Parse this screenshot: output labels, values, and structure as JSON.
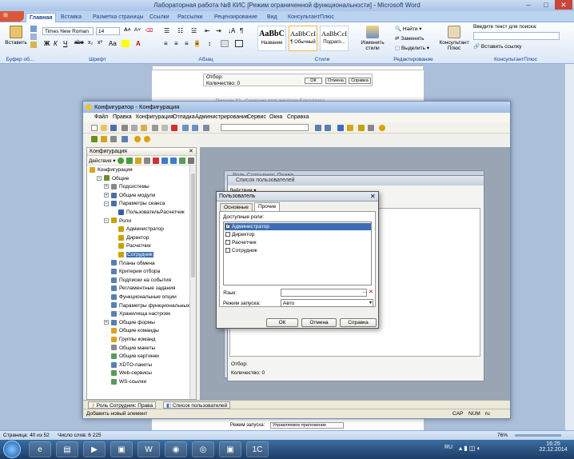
{
  "word": {
    "title": "Лабораторная работа №8 КИС [Режим ограниченной функциональности] - Microsoft Word",
    "tabs": [
      "Главная",
      "Вставка",
      "Разметка страницы",
      "Ссылки",
      "Рассылки",
      "Рецензирование",
      "Вид",
      "КонсультантПлюс"
    ],
    "font_name": "Times New Roman",
    "font_size": "14",
    "paste_label": "Вставить",
    "styles": [
      {
        "preview": "AaBbC",
        "name": "Название"
      },
      {
        "preview": "AaBbCcI",
        "name": "¶ Обычный"
      },
      {
        "preview": "AaBbCcI",
        "name": "Подзаго..."
      }
    ],
    "change_styles": "Изменить стили",
    "find": "Найти",
    "replace": "Заменить",
    "select": "Выделить",
    "consultant": "Консультант Плюс",
    "search_label": "Введите текст для поиска:",
    "insert_link": "Вставить ссылку",
    "groups": [
      "Буфер об...",
      "Шрифт",
      "Абзац",
      "Стили",
      "Редактирование",
      "КонсультантПлюс"
    ],
    "status": {
      "page": "Страница: 40 из 52",
      "words": "Число слов: 6 225",
      "zoom": "76%"
    },
    "page_snippet": {
      "selection": "Отбор:",
      "count": "Количество: 0",
      "ok": "ОК",
      "cancel": "Отмена",
      "help": "Справка",
      "caption": "Рисунок 32 - Создание пользователя Бухгалтера",
      "startup_label": "Режим запуска:",
      "startup_value": "Управляемое приложение"
    }
  },
  "taskbar": {
    "lang": "RU",
    "time": "16:25",
    "date": "22.12.2014"
  },
  "configurator": {
    "title": "Конфигуратор - Конфигурация",
    "menu": [
      "Файл",
      "Правка",
      "Конфигурация",
      "Отладка",
      "Администрирование",
      "Сервис",
      "Окна",
      "Справка"
    ],
    "tree_header": "Конфигурация",
    "tree_actions": "Действия",
    "tree": [
      {
        "label": "Конфигурация",
        "level": 0,
        "exp": "",
        "color": "#d9a520"
      },
      {
        "label": "Общие",
        "level": 1,
        "exp": "−",
        "color": "#6b8e23"
      },
      {
        "label": "Подсистемы",
        "level": 2,
        "exp": "+",
        "color": "#8a8a8a"
      },
      {
        "label": "Общие модули",
        "level": 2,
        "exp": "+",
        "color": "#4a6fa5"
      },
      {
        "label": "Параметры сеанса",
        "level": 2,
        "exp": "−",
        "color": "#4a6fa5"
      },
      {
        "label": "ПользовательРасчетчик",
        "level": 3,
        "exp": "",
        "color": "#2f5fa0"
      },
      {
        "label": "Роли",
        "level": 2,
        "exp": "−",
        "color": "#c8a200"
      },
      {
        "label": "Администратор",
        "level": 3,
        "exp": "",
        "color": "#c8a200"
      },
      {
        "label": "Директор",
        "level": 3,
        "exp": "",
        "color": "#c8a200"
      },
      {
        "label": "Расчетчик",
        "level": 3,
        "exp": "",
        "color": "#c8a200"
      },
      {
        "label": "Сотрудник",
        "level": 3,
        "exp": "",
        "color": "#c8a200",
        "selected": true
      },
      {
        "label": "Планы обмена",
        "level": 2,
        "exp": "",
        "color": "#5a7fb0"
      },
      {
        "label": "Критерии отбора",
        "level": 2,
        "exp": "",
        "color": "#5a7fb0"
      },
      {
        "label": "Подписки на события",
        "level": 2,
        "exp": "",
        "color": "#5a7fb0"
      },
      {
        "label": "Регламентные задания",
        "level": 2,
        "exp": "",
        "color": "#5a7fb0"
      },
      {
        "label": "Функциональные опции",
        "level": 2,
        "exp": "",
        "color": "#5a7fb0"
      },
      {
        "label": "Параметры функциональных опц",
        "level": 2,
        "exp": "",
        "color": "#5a7fb0"
      },
      {
        "label": "Хранилища настроек",
        "level": 2,
        "exp": "",
        "color": "#5a7fb0"
      },
      {
        "label": "Общие формы",
        "level": 2,
        "exp": "+",
        "color": "#5a7fb0"
      },
      {
        "label": "Общие команды",
        "level": 2,
        "exp": "",
        "color": "#d9a520"
      },
      {
        "label": "Группы команд",
        "level": 2,
        "exp": "",
        "color": "#d9a520"
      },
      {
        "label": "Общие макеты",
        "level": 2,
        "exp": "",
        "color": "#8a8a8a"
      },
      {
        "label": "Общие картинки",
        "level": 2,
        "exp": "",
        "color": "#5a9a5a"
      },
      {
        "label": "XDTO-пакеты",
        "level": 2,
        "exp": "",
        "color": "#5a7fb0"
      },
      {
        "label": "Web-сервисы",
        "level": 2,
        "exp": "",
        "color": "#5a9a5a"
      },
      {
        "label": "WS-ссылки",
        "level": 2,
        "exp": "",
        "color": "#5a9a5a"
      }
    ],
    "bottom_tabs": [
      "Роль Сотрудник: Права",
      "Список пользователей"
    ],
    "status_left": "Добавить новый элемент",
    "status_right": [
      "CAP",
      "NUM",
      "ru"
    ]
  },
  "users_window": {
    "title_back": "Роль Сотрудник: Права",
    "title": "Список пользователей",
    "actions": "Действия",
    "selection": "Отбор:",
    "count": "Количество: 0"
  },
  "dialog": {
    "title": "Пользователь",
    "tabs": [
      "Основные",
      "Прочие"
    ],
    "roles_label": "Доступные роли:",
    "roles": [
      {
        "name": "Администратор",
        "checked": true
      },
      {
        "name": "Директор",
        "checked": false
      },
      {
        "name": "Расчетчик",
        "checked": false
      },
      {
        "name": "Сотрудник",
        "checked": false
      }
    ],
    "language_label": "Язык:",
    "language_value": "",
    "startup_label": "Режим запуска:",
    "startup_value": "Авто",
    "ok": "ОК",
    "cancel": "Отмена",
    "help": "Справка"
  }
}
